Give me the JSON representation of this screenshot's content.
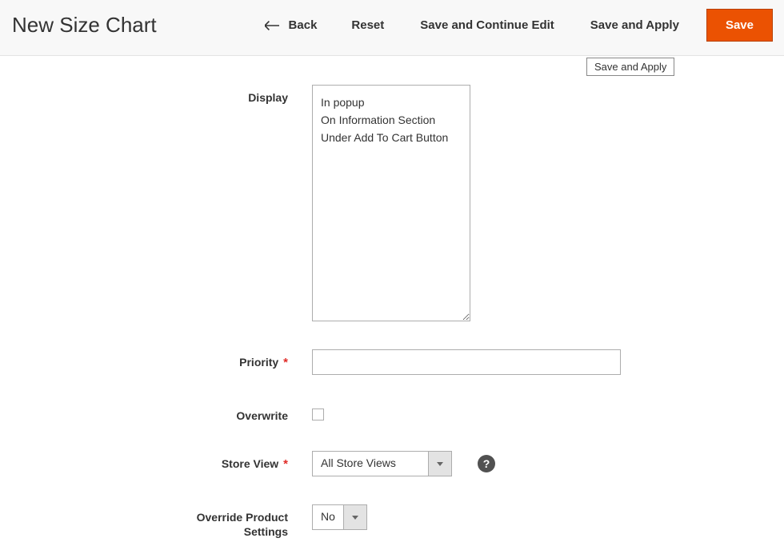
{
  "header": {
    "title": "New Size Chart",
    "back": "Back",
    "reset": "Reset",
    "save_continue": "Save and Continue Edit",
    "save_apply": "Save and Apply",
    "save": "Save"
  },
  "tooltip": "Save and Apply",
  "fields": {
    "display": {
      "label": "Display",
      "options": [
        "In popup",
        "On Information Section",
        "Under Add To Cart Button"
      ]
    },
    "priority": {
      "label": "Priority",
      "value": ""
    },
    "overwrite": {
      "label": "Overwrite"
    },
    "store_view": {
      "label": "Store View",
      "value": "All Store Views"
    },
    "override_product": {
      "label": "Override Product Settings",
      "value": "No"
    }
  }
}
